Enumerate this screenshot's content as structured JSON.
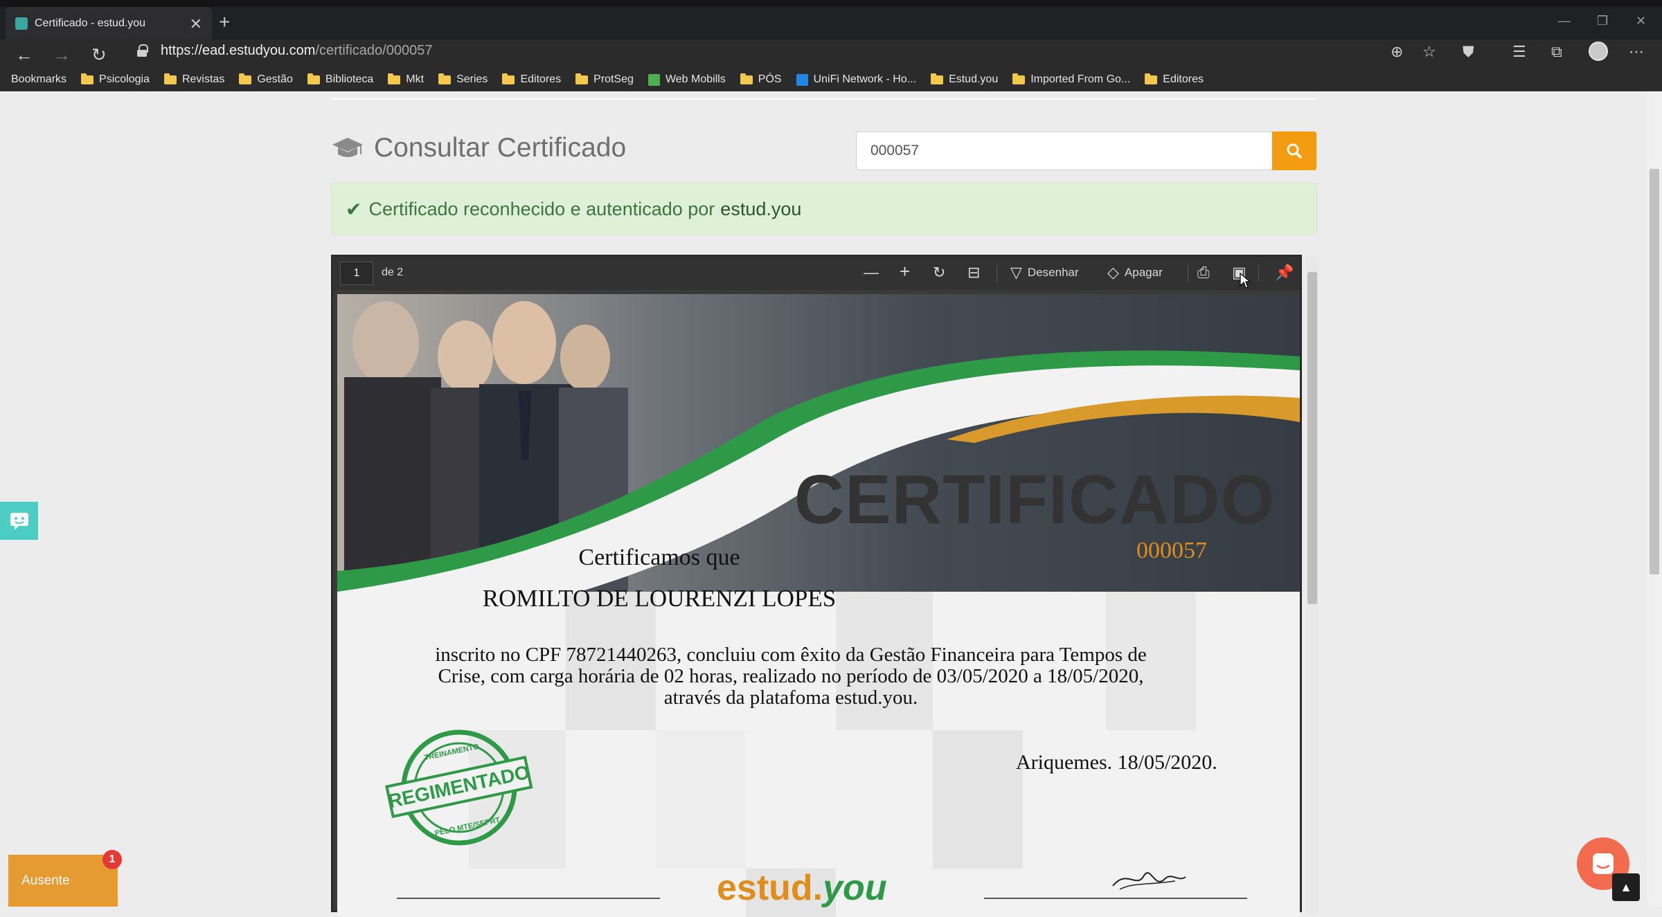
{
  "browser": {
    "tab_title": "Certificado - estud.you",
    "tab_close": "✕",
    "new_tab": "+",
    "url_host": "https://ead.estudyou.com",
    "url_path": "/certificado/000057"
  },
  "bookmarks": [
    {
      "label": "Bookmarks",
      "icon": "page-icon"
    },
    {
      "label": "Psicologia",
      "icon": "folder-icon"
    },
    {
      "label": "Revistas",
      "icon": "folder-icon"
    },
    {
      "label": "Gestão",
      "icon": "folder-icon"
    },
    {
      "label": "Biblioteca",
      "icon": "folder-icon"
    },
    {
      "label": "Mkt",
      "icon": "folder-icon"
    },
    {
      "label": "Series",
      "icon": "folder-icon"
    },
    {
      "label": "Editores",
      "icon": "folder-icon"
    },
    {
      "label": "ProtSeg",
      "icon": "folder-icon"
    },
    {
      "label": "Web Mobills",
      "icon": "app-icon"
    },
    {
      "label": "PÓS",
      "icon": "folder-icon"
    },
    {
      "label": "UniFi Network - Ho...",
      "icon": "unifi-icon"
    },
    {
      "label": "Estud.you",
      "icon": "folder-icon"
    },
    {
      "label": "Imported From Go...",
      "icon": "folder-icon"
    },
    {
      "label": "Editores",
      "icon": "folder-icon"
    }
  ],
  "page": {
    "heading": "Consultar Certificado",
    "search_value": "000057",
    "alert_text": "Certificado reconhecido e autenticado por",
    "alert_brand": "estud.you"
  },
  "viewer": {
    "page_number": "1",
    "page_total": "de 2",
    "draw_label": "Desenhar",
    "erase_label": "Apagar"
  },
  "certificate": {
    "title": "CERTIFICADO",
    "number": "000057",
    "lead": "Certificamos que",
    "name": "ROMILTO DE LOURENZI LOPES",
    "body_line1": "inscrito no CPF 78721440263, concluiu com êxito da Gestão Financeira para Tempos de",
    "body_line2": "Crise, com carga horária de 02 horas, realizado no período de 03/05/2020 a 18/05/2020,",
    "body_line3": "através da platafoma estud.you.",
    "place_date": "Ariquemes. 18/05/2020.",
    "stamp_top": "TREINAMENTO",
    "stamp_main": "REGIMENTADO",
    "stamp_bottom": "PELO MTE/SEPRT",
    "logo_main": "estud.",
    "logo_accent": "you"
  },
  "widgets": {
    "status_label": "Ausente",
    "badge_count": "1"
  },
  "colors": {
    "accent_orange": "#f39c12",
    "alert_green_bg": "#dff0d8",
    "alert_green_text": "#3c763d",
    "cert_green": "#2e9a47",
    "cert_gold": "#e08e1b"
  }
}
